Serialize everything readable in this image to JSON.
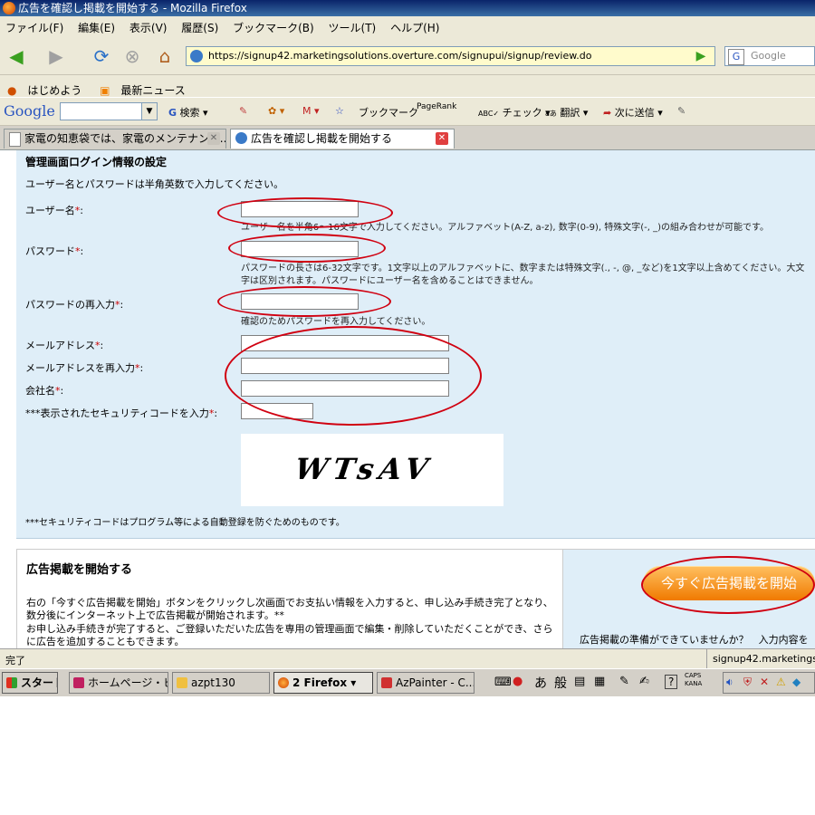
{
  "window": {
    "title": "広告を確認し掲載を開始する - Mozilla Firefox"
  },
  "menu": [
    "ファイル(F)",
    "編集(E)",
    "表示(V)",
    "履歴(S)",
    "ブックマーク(B)",
    "ツール(T)",
    "ヘルプ(H)"
  ],
  "nav": {
    "url": "https://signup42.marketingsolutions.overture.com/signupui/signup/review.do",
    "search_placeholder": "Google"
  },
  "bookmarks": [
    "はじめよう",
    "最新ニュース"
  ],
  "gtoolbar": {
    "logo": "Google",
    "search_label": "検索",
    "bookmark_label": "ブックマーク",
    "pagerank_label": "PageRank",
    "check_label": "チェック",
    "translate_label": "翻訳",
    "send_label": "次に送信"
  },
  "tabs": [
    {
      "label": "家電の知恵袋では、家電のメンテナンス...",
      "active": false
    },
    {
      "label": "広告を確認し掲載を開始する",
      "active": true
    }
  ],
  "form": {
    "section_title": "管理画面ログイン情報の設定",
    "instructions": "ユーザー名とパスワードは半角英数で入力してください。",
    "username_label": "ユーザー名",
    "username_hint": "ユーザー名を半角6～16文字で入力してください。アルファベット(A-Z, a-z), 数字(0-9), 特殊文字(-, _)の組み合わせが可能です。",
    "password_label": "パスワード",
    "password_hint1": "パスワードの長さは6-32文字です。1文字以上のアルファベットに、数字または特殊文字(., -, @, _など)を1文字以上含めてください。大文",
    "password_hint2": "字は区別されます。パスワードにユーザー名を含めることはできません。",
    "password_confirm_label": "パスワードの再入力",
    "password_confirm_hint": "確認のためパスワードを再入力してください。",
    "email_label": "メールアドレス",
    "email_confirm_label": "メールアドレスを再入力",
    "company_label": "会社名",
    "security_label": "***表示されたセキュリティコードを入力",
    "required_mark": "*",
    "captcha_text": "WTsAV",
    "security_note": "***セキュリティコードはプログラム等による自動登録を防ぐためのものです。"
  },
  "publish": {
    "title": "広告掲載を開始する",
    "line1": "右の「今すぐ広告掲載を開始」ボタンをクリックし次画面でお支払い情報を入力すると、申し込み手続き完了となり、",
    "line2": "数分後にインターネット上で広告掲載が開始されます。**",
    "line3": "お申し込み手続きが完了すると、ご登録いただいた広告を専用の管理画面で編集・削除していただくことができ、さら",
    "line4": "に広告を追加することもできます。",
    "button_label": "今すぐ広告掲載を開始",
    "not_ready_text": "広告掲載の準備ができていませんか？　入力内容を"
  },
  "status": {
    "left": "完了",
    "right": "signup42.marketingsolu"
  },
  "taskbar": {
    "start": "スタート",
    "items": [
      "ホームページ・ビ...",
      "azpt130",
      "2 Firefox",
      "AzPainter - C..."
    ],
    "ime_a": "あ",
    "ime_mode": "般",
    "caps": "CAPS",
    "kana": "KANA"
  }
}
